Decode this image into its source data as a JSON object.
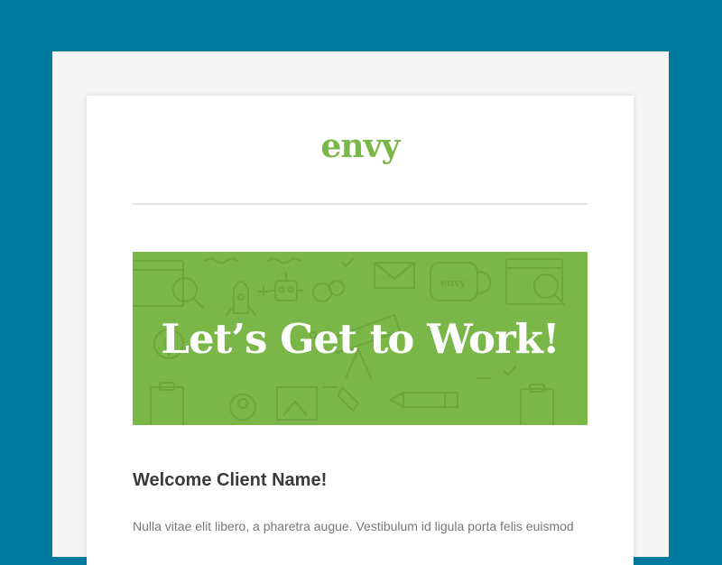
{
  "colors": {
    "background": "#00799f",
    "brand_green": "#7ab648",
    "banner_line": "#6ea53e",
    "heading_text": "#3a3a3a",
    "body_text": "#777777"
  },
  "email": {
    "logo_text": "envy",
    "banner": {
      "title": "Let’s Get to Work!",
      "icons": [
        "browser-search-icon",
        "rocket-icon",
        "robot-icon",
        "chat-bubble-icon",
        "envelope-icon",
        "coffee-mug-icon",
        "telescope-icon",
        "compass-icon",
        "clipboard-icon",
        "user-icon",
        "pen-nib-icon",
        "pencil-icon",
        "picture-icon",
        "magnifier-icon"
      ],
      "mug_label": "envy"
    },
    "welcome_heading": "Welcome Client Name!",
    "body_paragraph": "Nulla vitae elit libero, a pharetra augue. Vestibulum id ligula porta felis euismod"
  }
}
